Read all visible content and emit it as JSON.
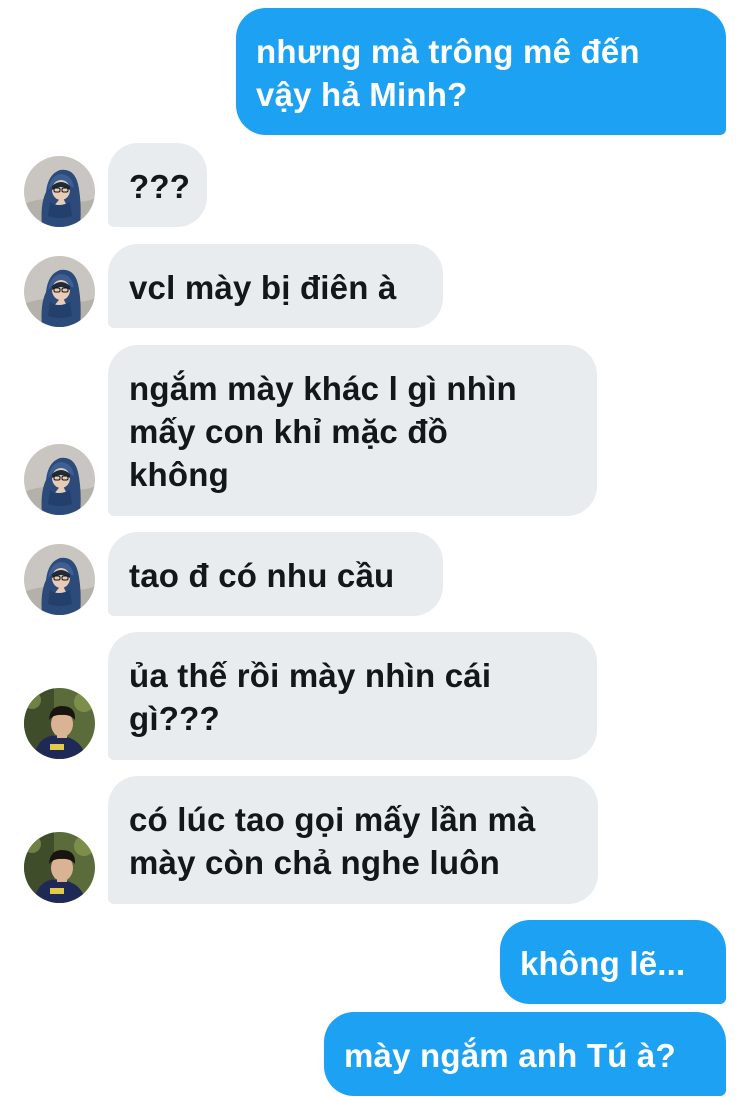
{
  "messages": [
    {
      "direction": "outgoing",
      "text": "nhưng mà trông mê đến\nvậy hả Minh?"
    },
    {
      "direction": "incoming",
      "avatar": "avatar-girl-hoodie",
      "text": "???"
    },
    {
      "direction": "incoming",
      "avatar": "avatar-girl-hoodie",
      "text": "vcl mày bị điên à"
    },
    {
      "direction": "incoming",
      "avatar": "avatar-girl-hoodie",
      "text": "ngắm mày khác l gì nhìn\nmấy con khỉ mặc đồ\nkhông"
    },
    {
      "direction": "incoming",
      "avatar": "avatar-girl-hoodie",
      "text": "tao đ có nhu cầu"
    },
    {
      "direction": "incoming",
      "avatar": "avatar-boy-navy-shirt",
      "text": "ủa thế rồi mày nhìn cái\ngì???"
    },
    {
      "direction": "incoming",
      "avatar": "avatar-boy-navy-shirt",
      "text": "có lúc tao gọi mấy lần mà\nmày còn chả nghe luôn"
    },
    {
      "direction": "outgoing",
      "text": "không lẽ..."
    },
    {
      "direction": "outgoing",
      "text": "mày ngắm anh Tú à?"
    }
  ],
  "colors": {
    "outgoing_bubble": "#1da1f2",
    "outgoing_text": "#ffffff",
    "incoming_bubble": "#e8ecef",
    "incoming_text": "#14171a",
    "background": "#ffffff"
  }
}
